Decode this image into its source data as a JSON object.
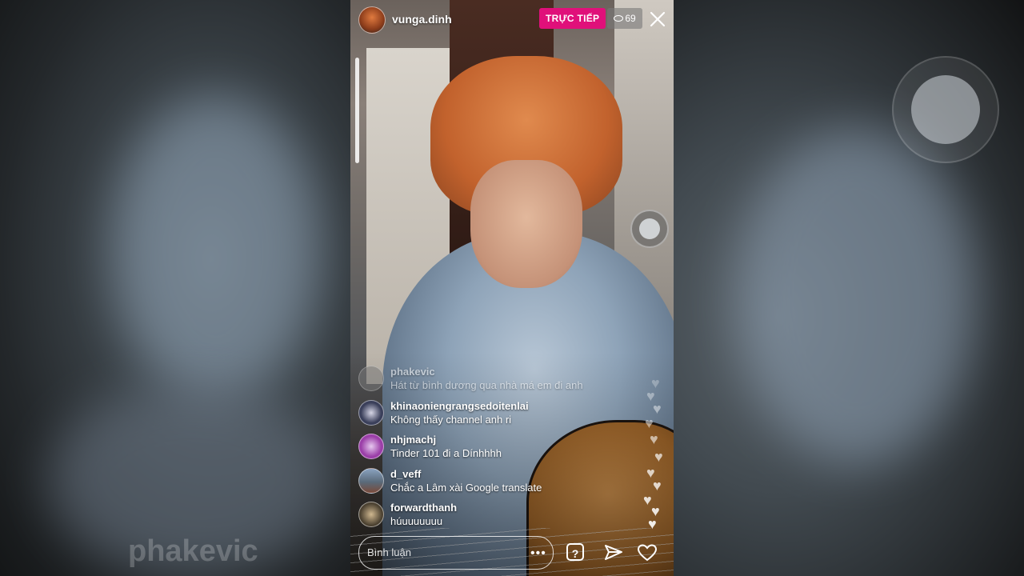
{
  "watermark": "phakevic",
  "header": {
    "username": "vunga.dinh",
    "live_label": "TRỰC TIẾP",
    "viewer_count": "69"
  },
  "comments": [
    {
      "user": "phakevic",
      "text": "Hát từ bình dương qua nhà má em đi anh",
      "avatar_color": "#7a7a7a"
    },
    {
      "user": "khinaoniengrangsedoitenlai",
      "text": "Không thấy channel anh ri",
      "avatar_color": "#3a3f5a"
    },
    {
      "user": "nhjmachj",
      "text": "Tinder 101 đi a Dínhhhh",
      "avatar_color": "#9b3fa8"
    },
    {
      "user": "d_veff",
      "text": "Chắc a Lâm xài Google translate",
      "avatar_color": "#5a6a7a"
    },
    {
      "user": "forwardthanh",
      "text": "húuuuuuuu",
      "avatar_color": "#4a4030"
    }
  ],
  "footer": {
    "comment_placeholder": "Bình luận"
  },
  "icons": [
    "eye-icon",
    "close-icon",
    "more-icon",
    "question-icon",
    "send-icon",
    "heart-icon"
  ]
}
